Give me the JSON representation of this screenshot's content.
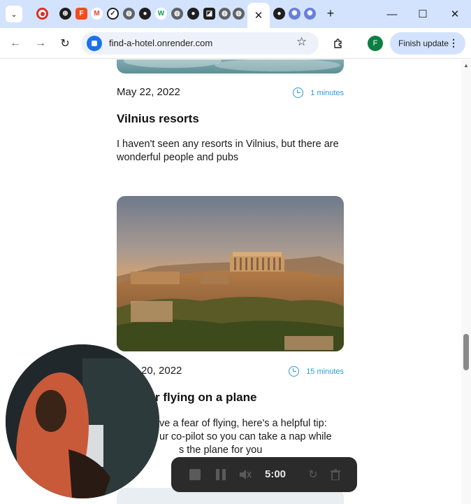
{
  "browser": {
    "tabs": {
      "active_close": "✕",
      "new_tab": "+"
    },
    "window": {
      "minimize": "—",
      "maximize": "☐",
      "close": "✕"
    },
    "address": {
      "url": "find-a-hotel.onrender.com"
    },
    "profile_initial": "F",
    "update_label": "Finish update"
  },
  "posts": [
    {
      "date": "May 22, 2022",
      "read_time": "1 minutes",
      "title": "Vilnius resorts",
      "text": "I haven't seen any resorts in Vilnius, but there are wonderful people and pubs"
    },
    {
      "date": "20, 2022",
      "read_time": "15 minutes",
      "title": "r flying on a plane",
      "text_line1": "ve a fear of flying, here's a helpful tip:",
      "text_line2": "ur co-pilot so you can take a nap while",
      "text_line3": "s the plane for you"
    }
  ],
  "recorder": {
    "timer": "5:00"
  },
  "colors": {
    "accent": "#2e9bd4",
    "tabstrip": "#d3e3fd"
  }
}
